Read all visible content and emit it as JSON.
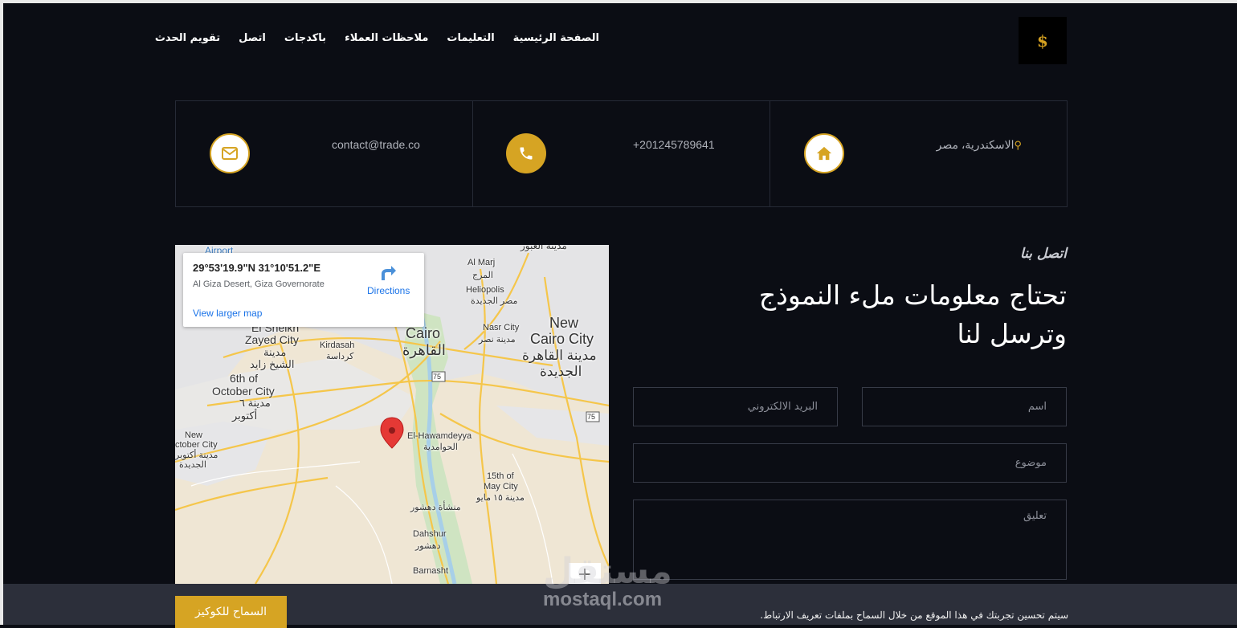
{
  "brand": {
    "logo_text": "$"
  },
  "nav": {
    "items": [
      {
        "label": "الصفحة الرئيسية"
      },
      {
        "label": "التعليمات"
      },
      {
        "label": "ملاحظات العملاء"
      },
      {
        "label": "باكدجات"
      },
      {
        "label": "اتصل"
      },
      {
        "label": "تقويم الحدث"
      }
    ]
  },
  "contact_info": {
    "address": "الاسكندرية، مصر",
    "phone": "+201245789641",
    "email": "contact@trade.co"
  },
  "map": {
    "coords": "29°53'19.9\"N 31°10'51.2\"E",
    "address": "Al Giza Desert, Giza Governorate",
    "directions_label": "Directions",
    "larger_map_label": "View larger map",
    "zoom_in_label": "+",
    "places": {
      "airport": "Airport",
      "obour": "مدينة العبور",
      "al_marj": "Al Marj",
      "al_marj_ar": "المرج",
      "heliopolis": "Heliopolis",
      "heliopolis_ar": "مصر الجديدة",
      "sheikh_zayed_1": "El Sheikh",
      "sheikh_zayed_2": "Zayed City",
      "sheikh_zayed_ar1": "مدينة",
      "sheikh_zayed_ar2": "الشيخ زايد",
      "kirdasah": "Kirdasah",
      "kirdasah_ar": "كرداسة",
      "cairo": "Cairo",
      "cairo_ar": "القاهرة",
      "nasr_city": "Nasr City",
      "nasr_city_ar": "مدينة نصر",
      "new_cairo_1": "New",
      "new_cairo_2": "Cairo City",
      "new_cairo_ar1": "مدينة القاهرة",
      "new_cairo_ar2": "الجديدة",
      "october_1": "6th of",
      "october_2": "October City",
      "october_ar1": "مدينة ٦",
      "october_ar2": "أكتوبر",
      "new_october_1": "New",
      "new_october_2": "ctober City",
      "new_october_ar1": "مدينة أكتوبر",
      "new_october_ar2": "الجديدة",
      "hawamdeyya": "El-Hawamdeyya",
      "hawamdeyya_ar": "الحوامدية",
      "may_city_1": "15th of",
      "may_city_2": "May City",
      "may_city_ar": "مدينة ١٥ مايو",
      "dahshur_village": "منشأة دهشور",
      "dahshur": "Dahshur",
      "dahshur_ar": "دهشور",
      "barnasht": "Barnasht",
      "road_75a": "75",
      "road_75b": "75"
    }
  },
  "form": {
    "eyebrow": "اتصل بنا",
    "headline": "تحتاج معلومات ملء النموذج وترسل لنا",
    "name_placeholder": "اسم",
    "email_placeholder": "البريد الالكتروني",
    "subject_placeholder": "موضوع",
    "comment_placeholder": "تعليق"
  },
  "cookie": {
    "text": "سيتم تحسين تجربتك في هذا الموقع من خلال السماح بملفات تعريف الارتباط.",
    "button_label": "السماح للكوكيز"
  },
  "watermark": {
    "logo": "مستقل",
    "url": "mostaql.com"
  },
  "colors": {
    "background": "#0b0d14",
    "accent": "#d6a423",
    "border": "#262a36",
    "cookie_bar": "#2c2f3a"
  }
}
